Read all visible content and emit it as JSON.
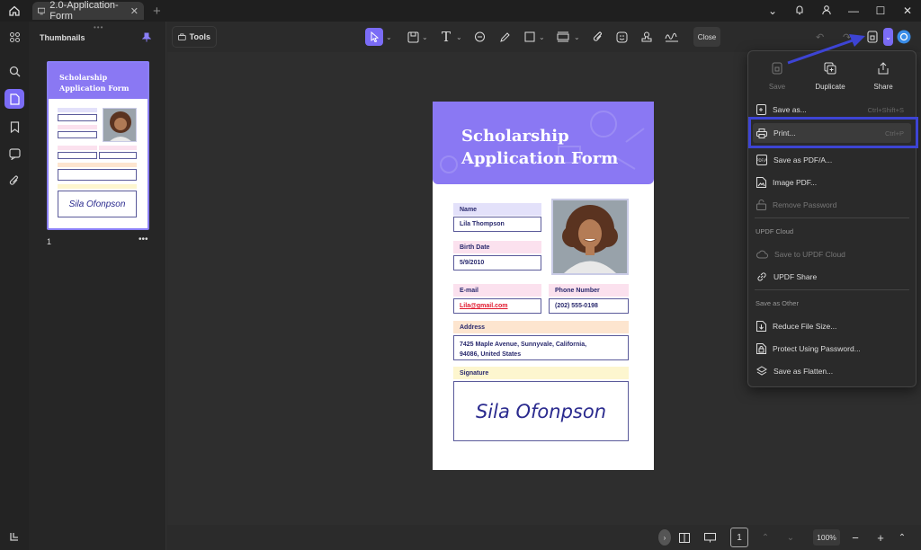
{
  "titlebar": {
    "tab_title": "2.0-Application-Form"
  },
  "thumbnails": {
    "title": "Thumbnails",
    "page_number": "1"
  },
  "toolbar": {
    "tools_label": "Tools",
    "close_label": "Close"
  },
  "form": {
    "title_line1": "Scholarship",
    "title_line2": "Application Form",
    "name_label": "Name",
    "name_value": "Lila Thompson",
    "birth_label": "Birth Date",
    "birth_value": "5/9/2010",
    "email_label": "E-mail",
    "email_value": "Lila@gmail.com",
    "phone_label": "Phone Number",
    "phone_value": "(202) 555-0198",
    "address_label": "Address",
    "address_line1": "7425 Maple Avenue, Sunnyvale, California,",
    "address_line2": "94086, United States",
    "signature_label": "Signature",
    "signature_value": "Sila Ofonpson"
  },
  "menu": {
    "save": "Save",
    "duplicate": "Duplicate",
    "share": "Share",
    "save_as": "Save as...",
    "save_as_shortcut": "Ctrl+Shift+S",
    "print": "Print...",
    "print_shortcut": "Ctrl+P",
    "save_pdfa": "Save as PDF/A...",
    "image_pdf": "Image PDF...",
    "remove_password": "Remove Password",
    "section_cloud": "UPDF Cloud",
    "save_cloud": "Save to UPDF Cloud",
    "updf_share": "UPDF Share",
    "section_other": "Save as Other",
    "reduce": "Reduce File Size...",
    "protect": "Protect Using Password...",
    "flatten": "Save as Flatten..."
  },
  "status": {
    "zoom": "100%",
    "page_input": "1"
  },
  "colors": {
    "accent": "#7b6cf6",
    "header": "#8a78f3",
    "highlight": "#3d44d4"
  }
}
